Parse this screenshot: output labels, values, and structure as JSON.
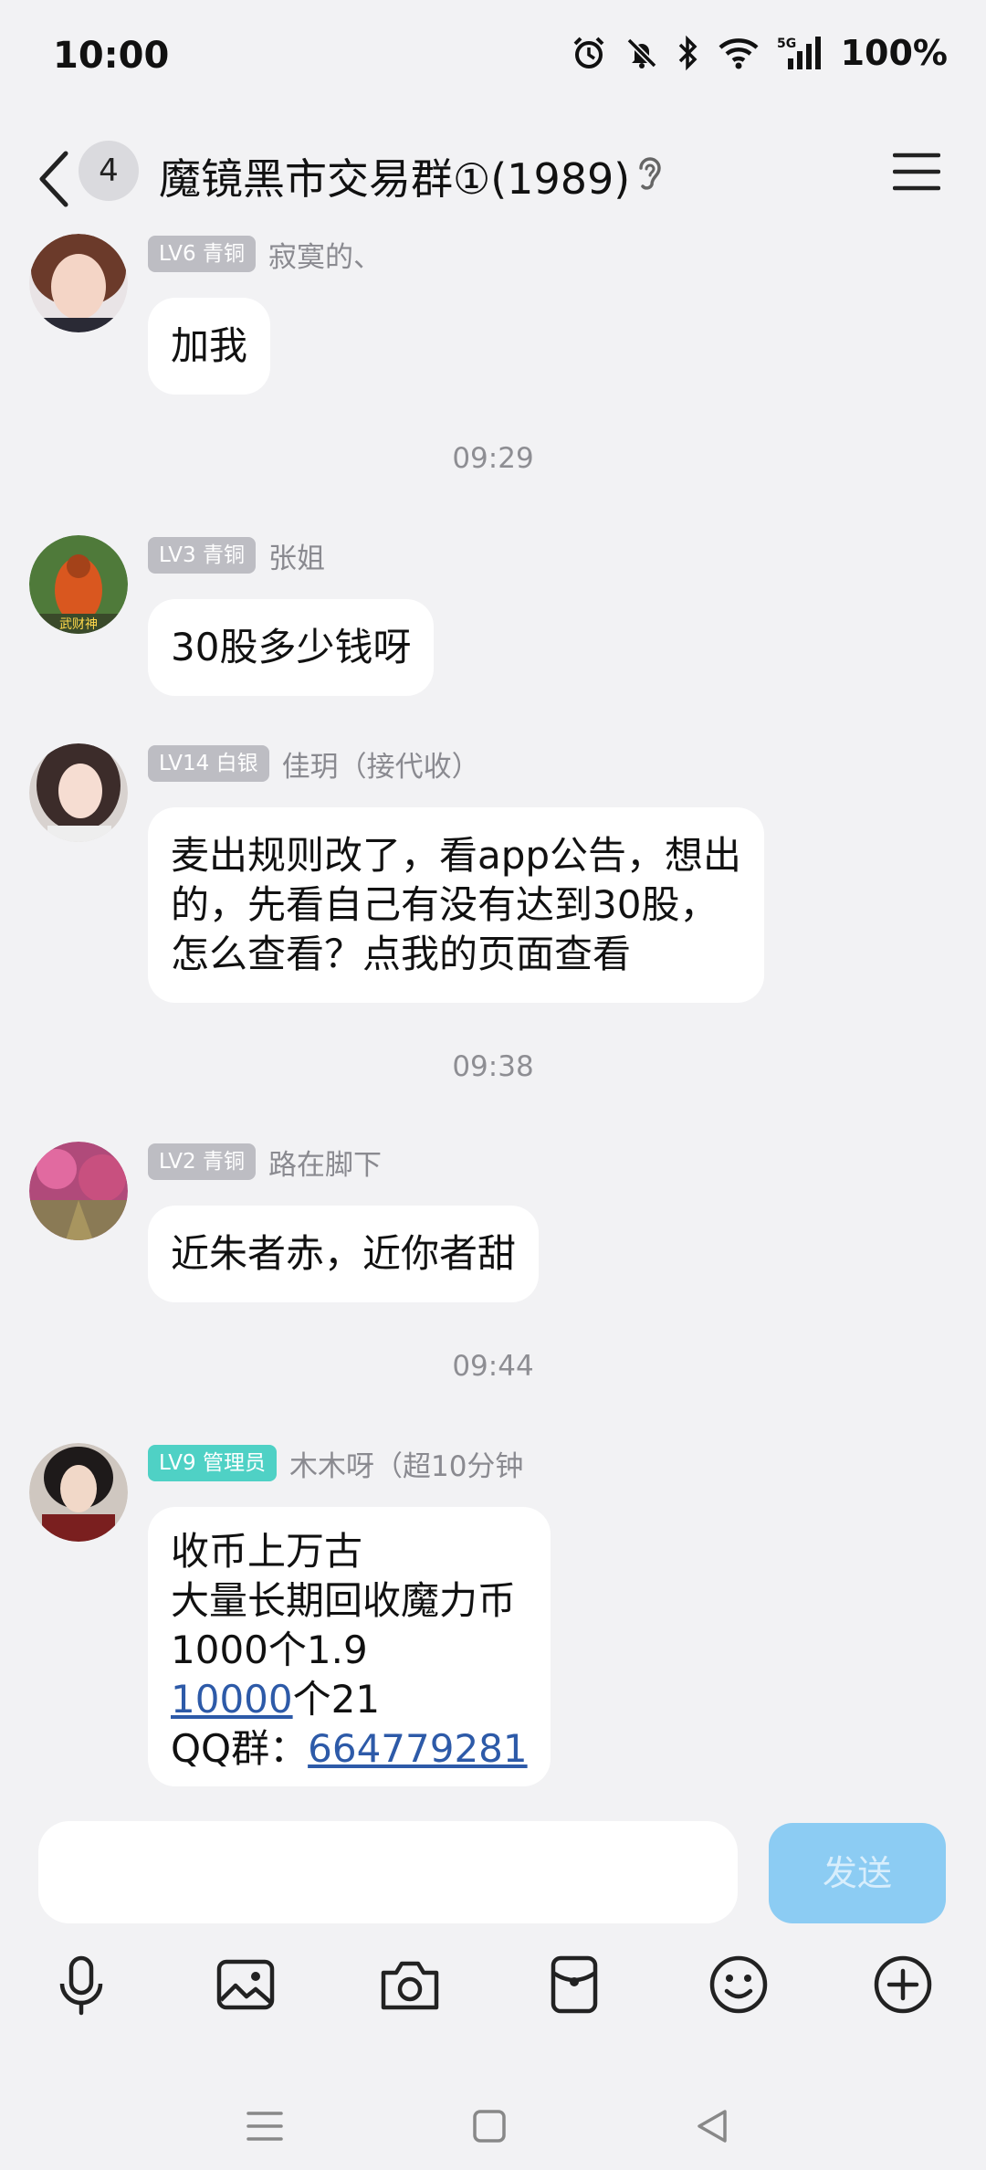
{
  "status_bar": {
    "time": "10:00",
    "battery": "100%",
    "network": "5G"
  },
  "header": {
    "unread_count": "4",
    "group_title": "魔镜黑市交易群①(1989)"
  },
  "messages": [
    {
      "level": "LV6 青铜",
      "sender": "寂寞的、",
      "text": "加我"
    },
    {
      "time": "09:29"
    },
    {
      "level": "LV3 青铜",
      "sender": "张姐",
      "text": "30股多少钱呀"
    },
    {
      "level": "LV14 白银",
      "sender": "佳玥（接代收）",
      "text": "麦出规则改了，看app公告，想出\n的，先看自己有没有达到30股，\n怎么查看？点我的页面查看"
    },
    {
      "time": "09:38"
    },
    {
      "level": "LV2 青铜",
      "sender": "路在脚下",
      "text": "近朱者赤，近你者甜"
    },
    {
      "time": "09:44"
    },
    {
      "level": "LV9 管理员",
      "sender": "木木呀（超10分钟",
      "lines": [
        "收币上万古",
        "大量长期回收魔力币",
        "1000个1.9"
      ],
      "line4_link": "10000",
      "line4_rest": "个21",
      "line5_prefix": "QQ群：",
      "line5_link": "664779281"
    }
  ],
  "input": {
    "placeholder": "",
    "send_label": "发送"
  },
  "colors": {
    "admin_badge": "#4fd1c5",
    "send_button": "#8cccf3",
    "link": "#2d5aa8"
  }
}
